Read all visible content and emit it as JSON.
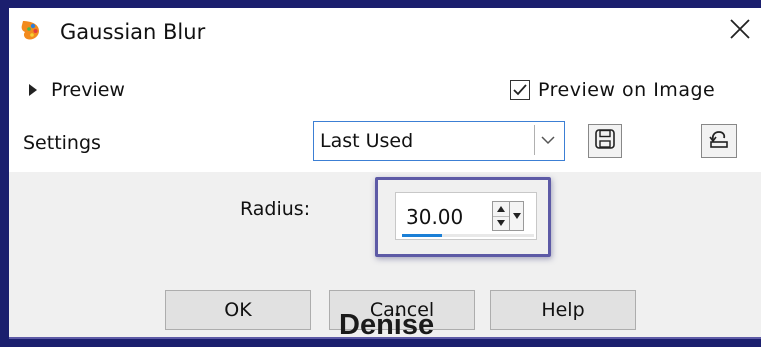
{
  "window": {
    "title": "Gaussian Blur",
    "app_icon": "paintshop-pro-icon",
    "close_icon": "close-icon"
  },
  "preview": {
    "toggle_label": "Preview",
    "toggle_icon": "triangle-right-icon",
    "preview_on_image_label": "Preview on Image",
    "preview_on_image_checked": true
  },
  "settings": {
    "label": "Settings",
    "preset_value": "Last Used",
    "save_icon": "floppy-disk-icon",
    "reset_icon": "reset-preset-icon"
  },
  "radius": {
    "label": "Radius:",
    "value": "30.00",
    "slider_fraction": 0.3
  },
  "buttons": {
    "ok": "OK",
    "cancel": "Cancel",
    "help": "Help"
  },
  "watermark": "Denise",
  "colors": {
    "highlight": "#5d5aa6",
    "accent": "#1b7fd6",
    "panel": "#f0f0f0"
  }
}
